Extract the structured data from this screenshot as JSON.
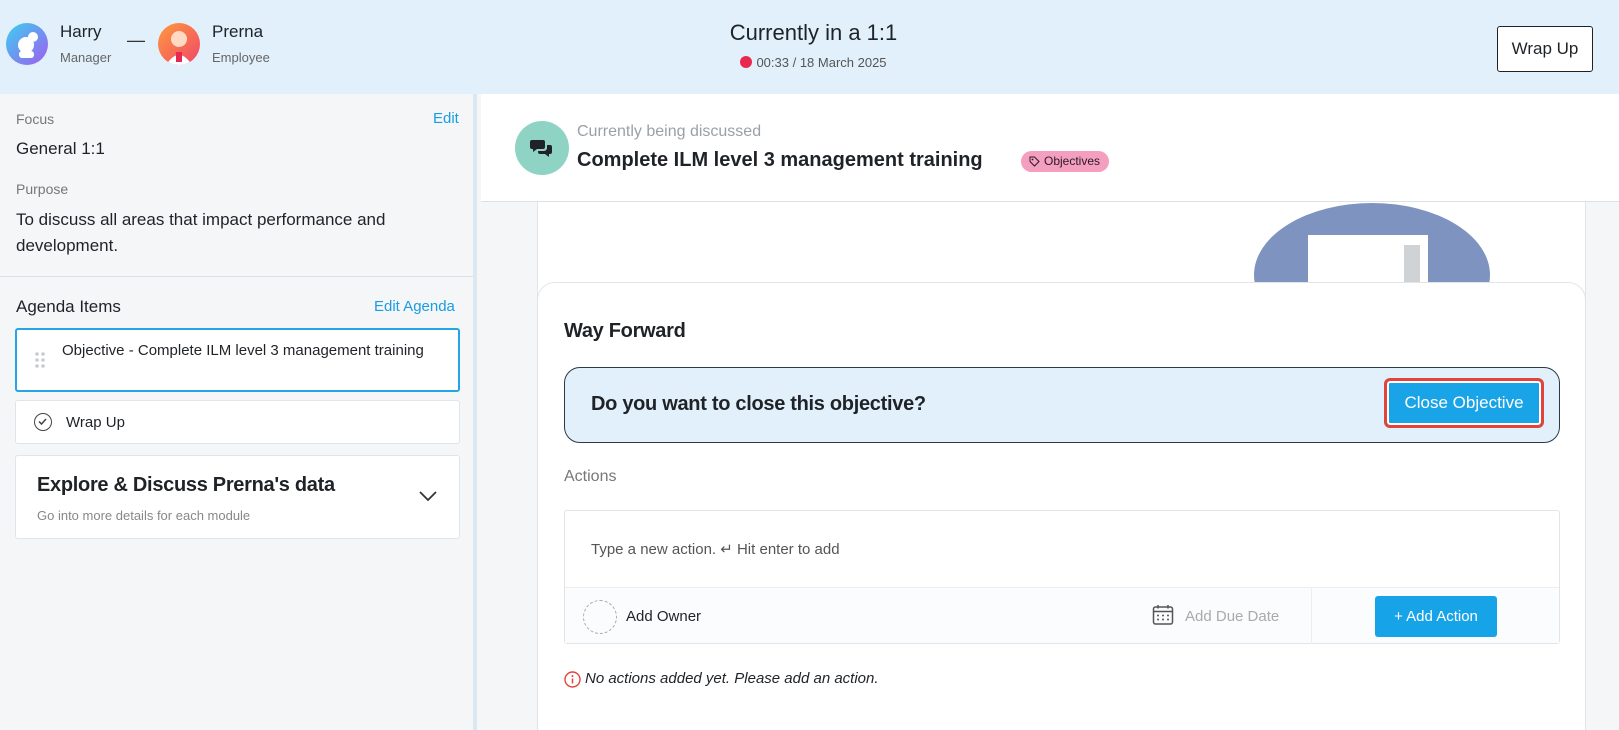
{
  "header": {
    "manager": {
      "name": "Harry",
      "role": "Manager"
    },
    "separator": "—",
    "employee": {
      "name": "Prerna",
      "role": "Employee"
    },
    "title": "Currently in a 1:1",
    "timer": "00:33 / 18 March 2025",
    "wrap_up_label": "Wrap Up"
  },
  "sidebar": {
    "focus_label": "Focus",
    "focus_value": "General 1:1",
    "edit_label": "Edit",
    "purpose_label": "Purpose",
    "purpose_value": "To discuss all areas that impact performance and development.",
    "agenda_title": "Agenda Items",
    "edit_agenda_label": "Edit Agenda",
    "agenda_items": [
      {
        "label": "Objective - Complete ILM level 3 management training",
        "active": true
      },
      {
        "label": "Wrap Up",
        "active": false
      }
    ],
    "explore": {
      "title": "Explore & Discuss Prerna's data",
      "subtitle": "Go into more details for each module"
    }
  },
  "main": {
    "discussing_label": "Currently being discussed",
    "discussing_title": "Complete ILM level 3 management training",
    "tag": "Objectives",
    "way_forward": {
      "title": "Way Forward",
      "close_question": "Do you want to close this objective?",
      "close_button": "Close Objective",
      "actions_label": "Actions",
      "action_placeholder": "Type a new action. ↵ Hit enter to add",
      "add_owner": "Add Owner",
      "add_due_date": "Add Due Date",
      "add_action": "+ Add Action",
      "empty_message": "No actions added yet. Please add an action."
    }
  },
  "colors": {
    "header_bg": "#e1f0fa",
    "accent": "#1aa4e8",
    "link": "#1a9ce0",
    "tag_bg": "#f49ec0",
    "recording": "#e8294f",
    "highlight_border": "#e0443a"
  }
}
